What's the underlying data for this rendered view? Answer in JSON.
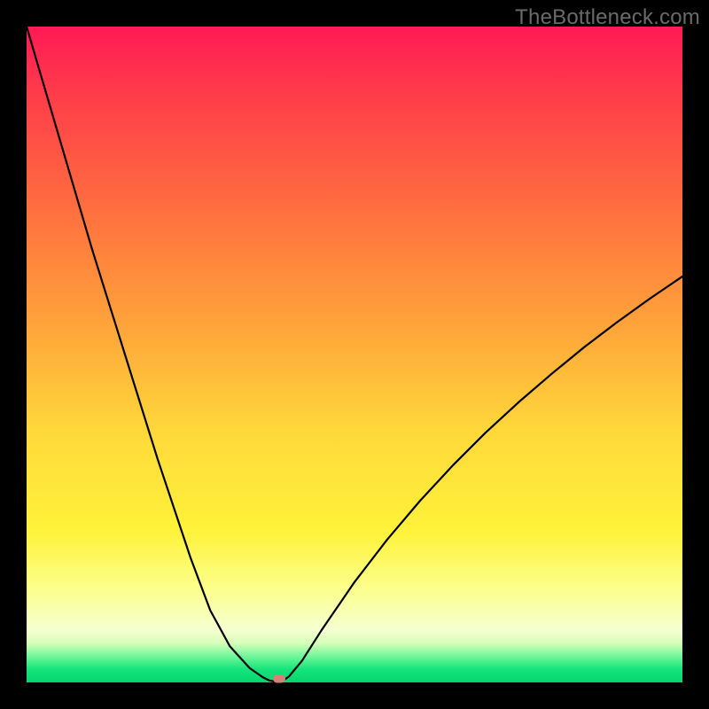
{
  "watermark": "TheBottleneck.com",
  "chart_data": {
    "type": "line",
    "title": "",
    "xlabel": "",
    "ylabel": "",
    "xlim": [
      0,
      100
    ],
    "ylim": [
      0,
      100
    ],
    "x": [
      0,
      5,
      10,
      15,
      20,
      25,
      28,
      31,
      34,
      36,
      37,
      38,
      38.5,
      39,
      40,
      42,
      45,
      50,
      55,
      60,
      65,
      70,
      75,
      80,
      85,
      90,
      95,
      100
    ],
    "values": [
      100,
      83,
      66,
      50,
      34,
      19,
      11,
      5.5,
      2.2,
      0.8,
      0.3,
      0.1,
      0,
      0.2,
      0.9,
      3.3,
      8.0,
      15.3,
      21.8,
      27.7,
      33.1,
      38.1,
      42.7,
      47.0,
      51.1,
      54.9,
      58.5,
      61.9
    ],
    "minimum_marker": {
      "x": 38.5,
      "y": 0.6
    },
    "colors": {
      "curve": "#000000",
      "marker": "#d98079",
      "gradient_top": "#ff1a55",
      "gradient_bottom": "#06d66e"
    }
  }
}
